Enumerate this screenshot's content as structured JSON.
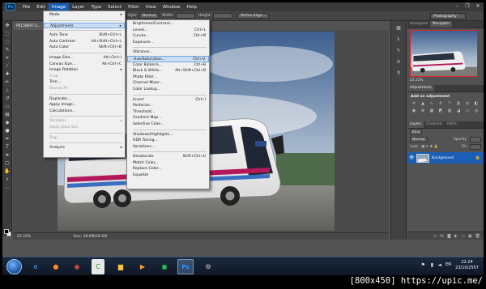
{
  "app": {
    "logo": "Ps",
    "menus": [
      "File",
      "Edit",
      "Image",
      "Layer",
      "Type",
      "Select",
      "Filter",
      "View",
      "Window",
      "Help"
    ],
    "active_menu": "Image"
  },
  "options_bar": {
    "style_label": "Style:",
    "style_value": "Normal",
    "width_label": "Width:",
    "height_label": "Height:",
    "refine_edge": "Refine Edge...",
    "workspace": "Photography"
  },
  "document": {
    "tab_title": "PK158897.S...",
    "zoom": "22.22%",
    "doc_size": "Doc: 28.6M/28.6M"
  },
  "image_menu": [
    {
      "label": "Mode",
      "arrow": true
    },
    {
      "sep": true
    },
    {
      "label": "Adjustments",
      "arrow": true,
      "highlight": true
    },
    {
      "sep": true
    },
    {
      "label": "Auto Tone",
      "shortcut": "Shift+Ctrl+L"
    },
    {
      "label": "Auto Contrast",
      "shortcut": "Alt+Shift+Ctrl+L"
    },
    {
      "label": "Auto Color",
      "shortcut": "Shift+Ctrl+B"
    },
    {
      "sep": true
    },
    {
      "label": "Image Size...",
      "shortcut": "Alt+Ctrl+I"
    },
    {
      "label": "Canvas Size...",
      "shortcut": "Alt+Ctrl+C"
    },
    {
      "label": "Image Rotation",
      "arrow": true
    },
    {
      "label": "Crop",
      "disabled": true
    },
    {
      "label": "Trim..."
    },
    {
      "label": "Reveal All",
      "disabled": true
    },
    {
      "sep": true
    },
    {
      "label": "Duplicate..."
    },
    {
      "label": "Apply Image..."
    },
    {
      "label": "Calculations..."
    },
    {
      "sep": true
    },
    {
      "label": "Variables",
      "arrow": true,
      "disabled": true
    },
    {
      "label": "Apply Data Set...",
      "disabled": true
    },
    {
      "sep": true
    },
    {
      "label": "Trap...",
      "disabled": true
    },
    {
      "sep": true
    },
    {
      "label": "Analysis",
      "arrow": true
    }
  ],
  "adjustments_menu": [
    {
      "label": "Brightness/Contrast..."
    },
    {
      "label": "Levels...",
      "shortcut": "Ctrl+L"
    },
    {
      "label": "Curves...",
      "shortcut": "Ctrl+M"
    },
    {
      "label": "Exposure..."
    },
    {
      "sep": true
    },
    {
      "label": "Vibrance..."
    },
    {
      "label": "Hue/Saturation...",
      "shortcut": "Ctrl+U",
      "highlight": true
    },
    {
      "label": "Color Balance...",
      "shortcut": "Ctrl+B"
    },
    {
      "label": "Black & White...",
      "shortcut": "Alt+Shift+Ctrl+B"
    },
    {
      "label": "Photo Filter..."
    },
    {
      "label": "Channel Mixer..."
    },
    {
      "label": "Color Lookup..."
    },
    {
      "sep": true
    },
    {
      "label": "Invert",
      "shortcut": "Ctrl+I"
    },
    {
      "label": "Posterize..."
    },
    {
      "label": "Threshold..."
    },
    {
      "label": "Gradient Map..."
    },
    {
      "label": "Selective Color..."
    },
    {
      "sep": true
    },
    {
      "label": "Shadows/Highlights..."
    },
    {
      "label": "HDR Toning..."
    },
    {
      "label": "Variations..."
    },
    {
      "sep": true
    },
    {
      "label": "Desaturate",
      "shortcut": "Shift+Ctrl+U"
    },
    {
      "label": "Match Color..."
    },
    {
      "label": "Replace Color..."
    },
    {
      "label": "Equalize"
    }
  ],
  "panels": {
    "top_tabs": [
      "Histogram",
      "Navigator"
    ],
    "navigator_zoom": "22.22%",
    "adjustments_tab": "Adjustments",
    "add_adjustment": "Add an adjustment",
    "layer_tabs": [
      "Layers",
      "Channels",
      "Paths"
    ],
    "kind": "Kind",
    "blend_mode": "Normal",
    "opacity_label": "Opacity:",
    "lock_label": "Lock:",
    "fill_label": "Fill:",
    "layer_name": "Background"
  },
  "taskbar": {
    "lang": "EN",
    "time": "22:24",
    "date": "23/10/2557"
  },
  "watermark": "[800x450] https://upic.me/",
  "colors": {
    "menu_highlight": "#1a5fb4",
    "item_highlight": "#c9ddf5",
    "navigator_frame": "#d8262b"
  }
}
